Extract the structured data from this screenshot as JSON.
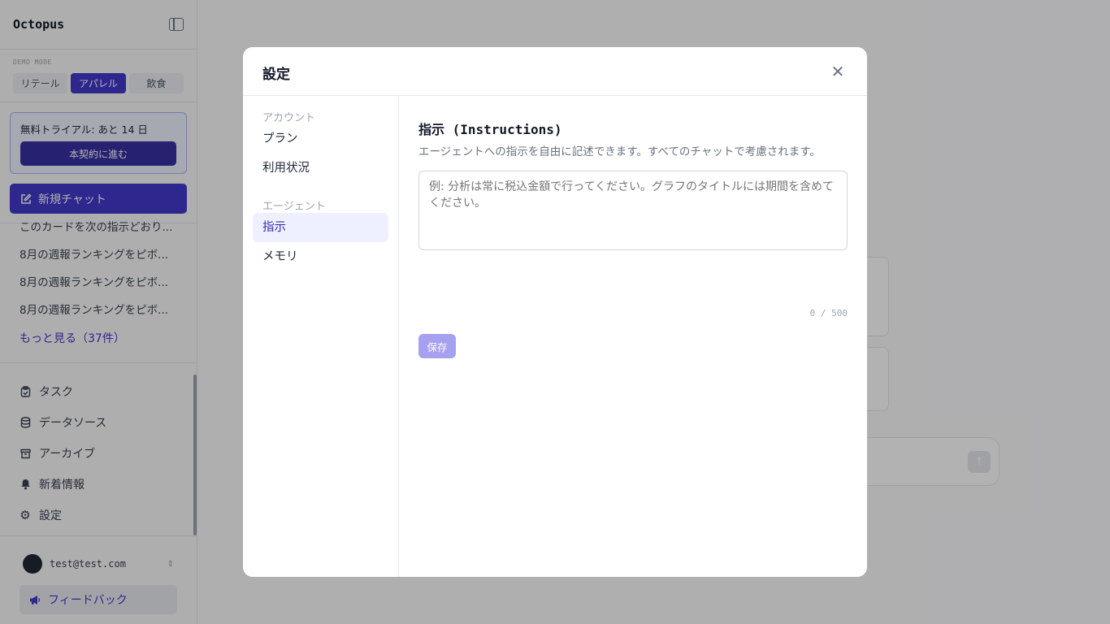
{
  "sidebar": {
    "brand": "Octopus",
    "demo_label": "DEMO MODE",
    "modes": [
      "リテール",
      "アパレル",
      "飲食"
    ],
    "trial_text": "無料トライアル: あと 14 日",
    "trial_button": "本契約に進む",
    "new_chat": "新規チャット",
    "history": [
      "このカードを次の指示どおり...",
      "8月の週報ランキングをピボ...",
      "8月の週報ランキングをピボ...",
      "8月の週報ランキングをピボ..."
    ],
    "more": "もっと見る（37件）",
    "nav": [
      {
        "label": "タスク",
        "icon": "clipboard-icon"
      },
      {
        "label": "データソース",
        "icon": "database-icon"
      },
      {
        "label": "アーカイブ",
        "icon": "archive-icon"
      },
      {
        "label": "新着情報",
        "icon": "bell-icon"
      },
      {
        "label": "設定",
        "icon": "gear-icon"
      }
    ],
    "user_email": "test@test.com",
    "feedback": "フィードバック"
  },
  "modal": {
    "title": "設定",
    "nav_groups": [
      {
        "label": "アカウント",
        "items": [
          "プラン",
          "利用状況"
        ]
      },
      {
        "label": "エージェント",
        "items": [
          "指示",
          "メモリ"
        ]
      }
    ],
    "active_item": "指示",
    "section_title": "指示 (Instructions)",
    "section_desc": "エージェントへの指示を自由に記述できます。すべてのチャットで考慮されます。",
    "textarea_placeholder": "例: 分析は常に税込金額で行ってください。グラフのタイトルには期間を含めてください。",
    "textarea_value": "",
    "counter": "0 / 500",
    "save": "保存"
  },
  "colors": {
    "accent": "#4338ca",
    "save_disabled": "#a5a0f0"
  }
}
